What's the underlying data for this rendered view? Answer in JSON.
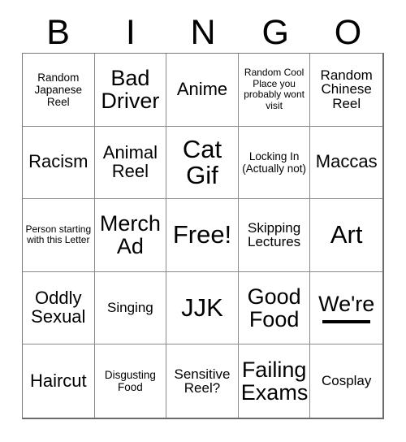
{
  "card": {
    "title": "BINGO",
    "header_letters": [
      "B",
      "I",
      "N",
      "G",
      "O"
    ],
    "rows": 5,
    "columns": 5,
    "free_space": {
      "row": 3,
      "column": 3,
      "label": "Free!"
    },
    "colors": {
      "background": "#ffffff",
      "text": "#000000",
      "grid_line": "#8a8a8a",
      "outer_border": "#6a6a6a"
    },
    "cells": [
      [
        {
          "text": "Random Japanese Reel",
          "size": "xs"
        },
        {
          "text": "Bad Driver",
          "size": "lg"
        },
        {
          "text": "Anime",
          "size": "md"
        },
        {
          "text": "Random Cool Place you probably wont visit",
          "size": "xxs"
        },
        {
          "text": "Random Chinese Reel",
          "size": "sm"
        }
      ],
      [
        {
          "text": "Racism",
          "size": "md"
        },
        {
          "text": "Animal Reel",
          "size": "md"
        },
        {
          "text": "Cat Gif",
          "size": "xl"
        },
        {
          "text": "Locking In (Actually not)",
          "size": "xs"
        },
        {
          "text": "Maccas",
          "size": "md"
        }
      ],
      [
        {
          "text": "Person starting with this Letter",
          "size": "xxs"
        },
        {
          "text": "Merch Ad",
          "size": "lg"
        },
        {
          "text": "Free!",
          "size": "xl"
        },
        {
          "text": "Skipping Lectures",
          "size": "sm"
        },
        {
          "text": "Art",
          "size": "xl"
        }
      ],
      [
        {
          "text": "Oddly Sexual",
          "size": "md"
        },
        {
          "text": "Singing",
          "size": "sm"
        },
        {
          "text": "JJK",
          "size": "xl"
        },
        {
          "text": "Good Food",
          "size": "lg"
        },
        {
          "text": "We're",
          "size": "lg",
          "blank": true
        }
      ],
      [
        {
          "text": "Haircut",
          "size": "md"
        },
        {
          "text": "Disgusting Food",
          "size": "xs"
        },
        {
          "text": "Sensitive Reel?",
          "size": "sm"
        },
        {
          "text": "Failing Exams",
          "size": "lg"
        },
        {
          "text": "Cosplay",
          "size": "sm"
        }
      ]
    ]
  }
}
